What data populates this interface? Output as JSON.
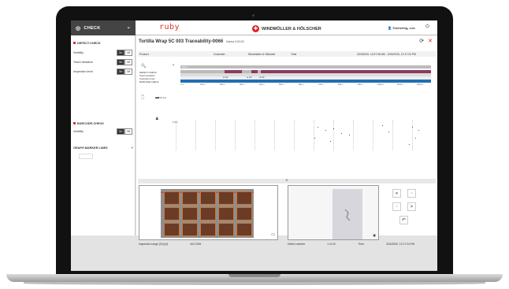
{
  "app": {
    "check_label": "CHECK",
    "logo_text": "ruby",
    "brand": "WINDMÖLLER & HÖLSCHER",
    "user": "Trichering, Lea"
  },
  "sidebar": {
    "defect_check": "DEFECT-CHECK",
    "rows": [
      {
        "label": "Visibility",
        "on": "On",
        "off": "Off"
      },
      {
        "label": "Teach deviation",
        "on": "On",
        "off": "Off"
      },
      {
        "label": "Inspection level",
        "on": "On",
        "off": "Off"
      }
    ],
    "barcode_check": "BARCODE-CHECK",
    "barcode_row": {
      "label": "Visibility",
      "on": "On",
      "off": "Off"
    },
    "graph_marker": "GRAPH MARKER LINES",
    "plus": "+"
  },
  "header": {
    "title": "Tortilla Wrap 5C 003 Traceability-0066",
    "subtitle": "Marma 0.00105"
  },
  "info": {
    "product_label": "Product",
    "customer_label": "Customer",
    "customer": "Windmöller & Hölscher",
    "time_label": "Time",
    "time": "3/24/2020, 11:57:46 AM - 3/24/2020, 12:17:23 PM"
  },
  "trace": {
    "roll_label": "Roll 1",
    "labels": [
      "DEFECT-CHECK",
      "Teach deviation",
      "Inspection level",
      "BARCODE-CHECK"
    ],
    "axis": [
      "0 m",
      "100 m",
      "200 m",
      "300 m",
      "400 m",
      "500 m",
      "600 m",
      "700 m",
      "800 m",
      "900 m",
      "1000 m",
      "1100 m",
      "1200 m"
    ],
    "markers": [
      "⊕ 2/2",
      "⊕ 2/2",
      "⊕ 2/2"
    ]
  },
  "plot": {
    "ylabel": "2,02 mm",
    "y0": "0 mm"
  },
  "footer": {
    "left_label": "Inspection range (Di) [m]",
    "left_value": "402.2239",
    "mid_label": "Defect number",
    "mid_value": "1 of 20",
    "time_label": "Time",
    "time_value": "3/24/2020, 12:17:24 PM"
  },
  "ctrl": {
    "prev": "«",
    "next": "»",
    "left": "<",
    "right": ">",
    "rot": "↶"
  },
  "colors": {
    "accent": "#d33",
    "purple": "#8b3a62",
    "blue": "#1f6fb5"
  }
}
